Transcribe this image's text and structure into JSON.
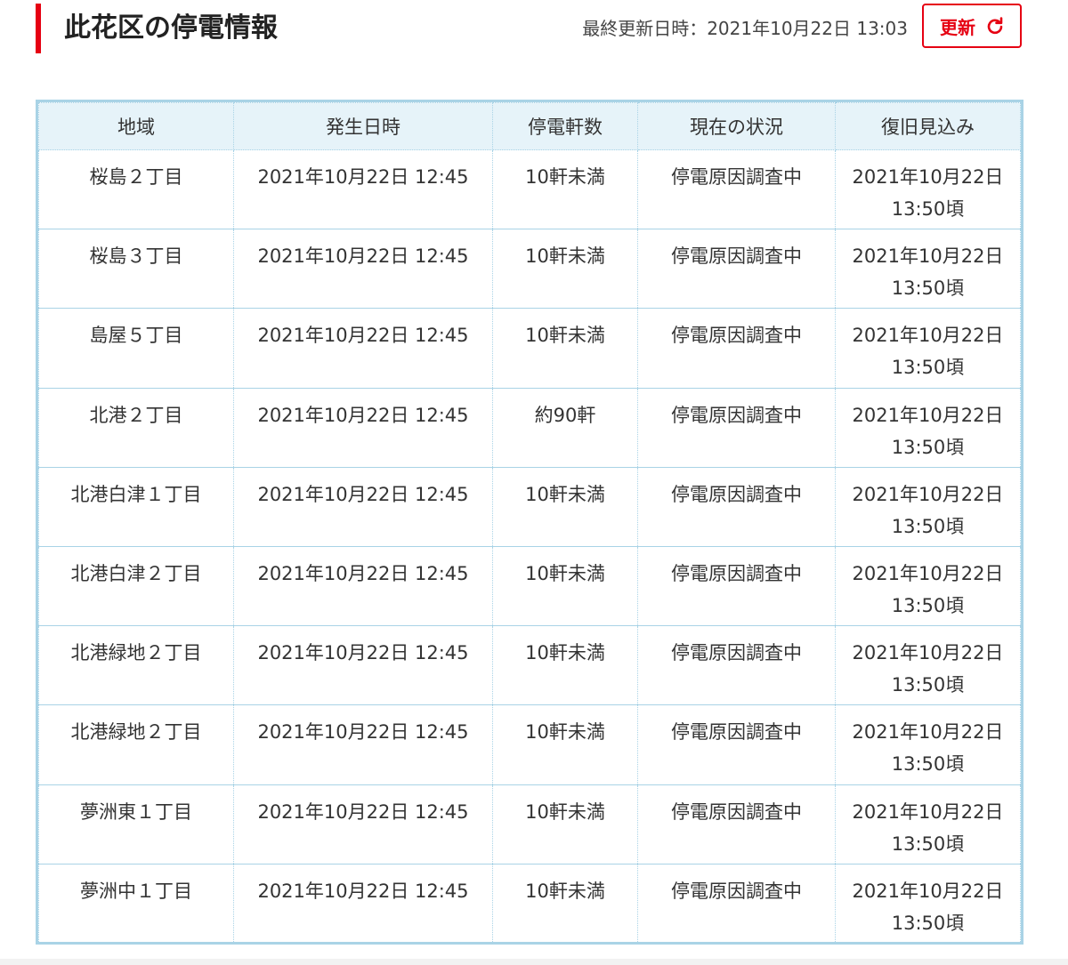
{
  "header": {
    "title": "此花区の停電情報",
    "updated_label": "最終更新日時：2021年10月22日 13:03",
    "refresh_label": "更新",
    "refresh_icon": "refresh-icon"
  },
  "colors": {
    "accent": "#e60012",
    "table_border": "#a9d3e6",
    "header_bg": "#e6f3f9"
  },
  "table": {
    "headers": [
      "地域",
      "発生日時",
      "停電軒数",
      "現在の状況",
      "復旧見込み"
    ],
    "rows": [
      {
        "area": "桜島２丁目",
        "occurred": "2021年10月22日 12:45",
        "count": "10軒未満",
        "status": "停電原因調査中",
        "eta_date": "2021年10月22日",
        "eta_time": "13:50頃"
      },
      {
        "area": "桜島３丁目",
        "occurred": "2021年10月22日 12:45",
        "count": "10軒未満",
        "status": "停電原因調査中",
        "eta_date": "2021年10月22日",
        "eta_time": "13:50頃"
      },
      {
        "area": "島屋５丁目",
        "occurred": "2021年10月22日 12:45",
        "count": "10軒未満",
        "status": "停電原因調査中",
        "eta_date": "2021年10月22日",
        "eta_time": "13:50頃"
      },
      {
        "area": "北港２丁目",
        "occurred": "2021年10月22日 12:45",
        "count": "約90軒",
        "status": "停電原因調査中",
        "eta_date": "2021年10月22日",
        "eta_time": "13:50頃"
      },
      {
        "area": "北港白津１丁目",
        "occurred": "2021年10月22日 12:45",
        "count": "10軒未満",
        "status": "停電原因調査中",
        "eta_date": "2021年10月22日",
        "eta_time": "13:50頃"
      },
      {
        "area": "北港白津２丁目",
        "occurred": "2021年10月22日 12:45",
        "count": "10軒未満",
        "status": "停電原因調査中",
        "eta_date": "2021年10月22日",
        "eta_time": "13:50頃"
      },
      {
        "area": "北港緑地２丁目",
        "occurred": "2021年10月22日 12:45",
        "count": "10軒未満",
        "status": "停電原因調査中",
        "eta_date": "2021年10月22日",
        "eta_time": "13:50頃"
      },
      {
        "area": "北港緑地２丁目",
        "occurred": "2021年10月22日 12:45",
        "count": "10軒未満",
        "status": "停電原因調査中",
        "eta_date": "2021年10月22日",
        "eta_time": "13:50頃"
      },
      {
        "area": "夢洲東１丁目",
        "occurred": "2021年10月22日 12:45",
        "count": "10軒未満",
        "status": "停電原因調査中",
        "eta_date": "2021年10月22日",
        "eta_time": "13:50頃"
      },
      {
        "area": "夢洲中１丁目",
        "occurred": "2021年10月22日 12:45",
        "count": "10軒未満",
        "status": "停電原因調査中",
        "eta_date": "2021年10月22日",
        "eta_time": "13:50頃"
      }
    ]
  }
}
